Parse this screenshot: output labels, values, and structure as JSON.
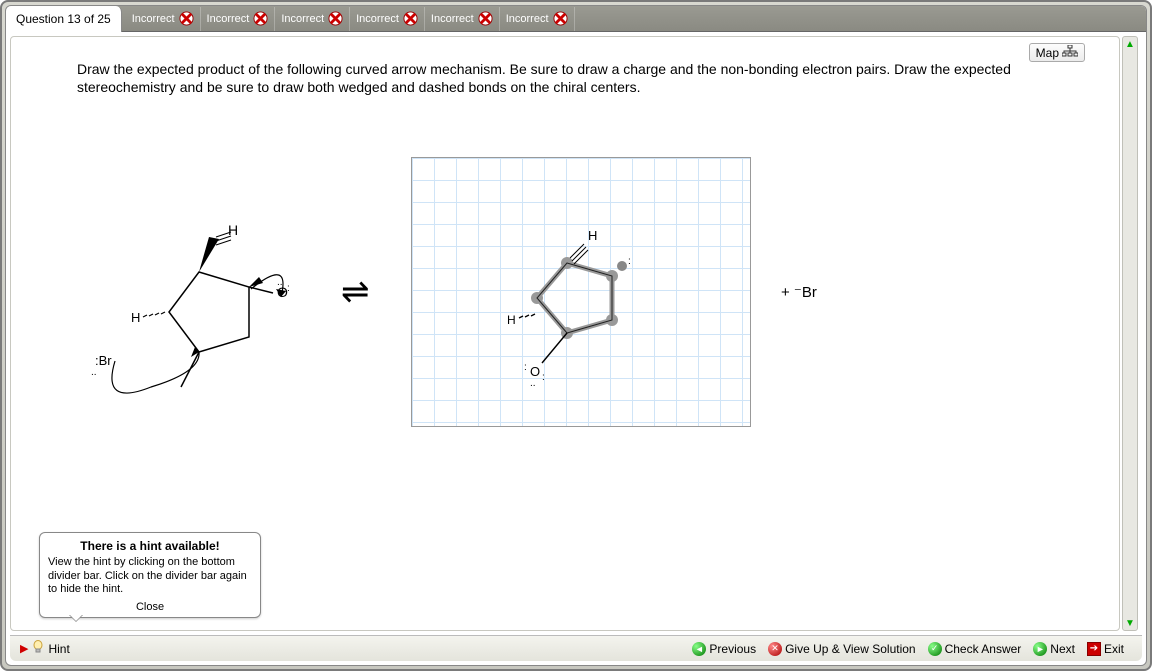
{
  "header": {
    "question_tab_label": "Question 13 of 25",
    "attempts": [
      {
        "label": "Incorrect"
      },
      {
        "label": "Incorrect"
      },
      {
        "label": "Incorrect"
      },
      {
        "label": "Incorrect"
      },
      {
        "label": "Incorrect"
      },
      {
        "label": "Incorrect"
      }
    ]
  },
  "map_button_label": "Map",
  "prompt": "Draw the expected product of the following curved arrow mechanism. Be sure to draw a charge and the non-bonding electron pairs. Draw the expected stereochemistry and be sure to draw both wedged and dashed bonds on the chiral centers.",
  "equilibrium_symbol": "⇌",
  "byproduct_text": "+  ⁻Br",
  "reactant": {
    "atoms": [
      "H",
      "H",
      "O",
      "Br"
    ],
    "description": "cyclopentane with wedge H (up), dash H (down-left), epoxide O with lone pairs, external :Br⁻ with curved arrow attacking, and C–O curved arrow breaking"
  },
  "student_drawing": {
    "atoms": [
      "H",
      "H",
      "O"
    ],
    "description": "cyclopentane ring (selected, grey nodes), wedge H up, dash H left, :O: substituent bottom with lone pairs, small group top-right"
  },
  "hint_popup": {
    "title": "There is a hint available!",
    "body": "View the hint by clicking on the bottom divider bar. Click on the divider bar again to hide the hint.",
    "close": "Close"
  },
  "bottom": {
    "hint_label": "Hint",
    "previous": "Previous",
    "giveup": "Give Up & View Solution",
    "check": "Check Answer",
    "next": "Next",
    "exit": "Exit"
  }
}
